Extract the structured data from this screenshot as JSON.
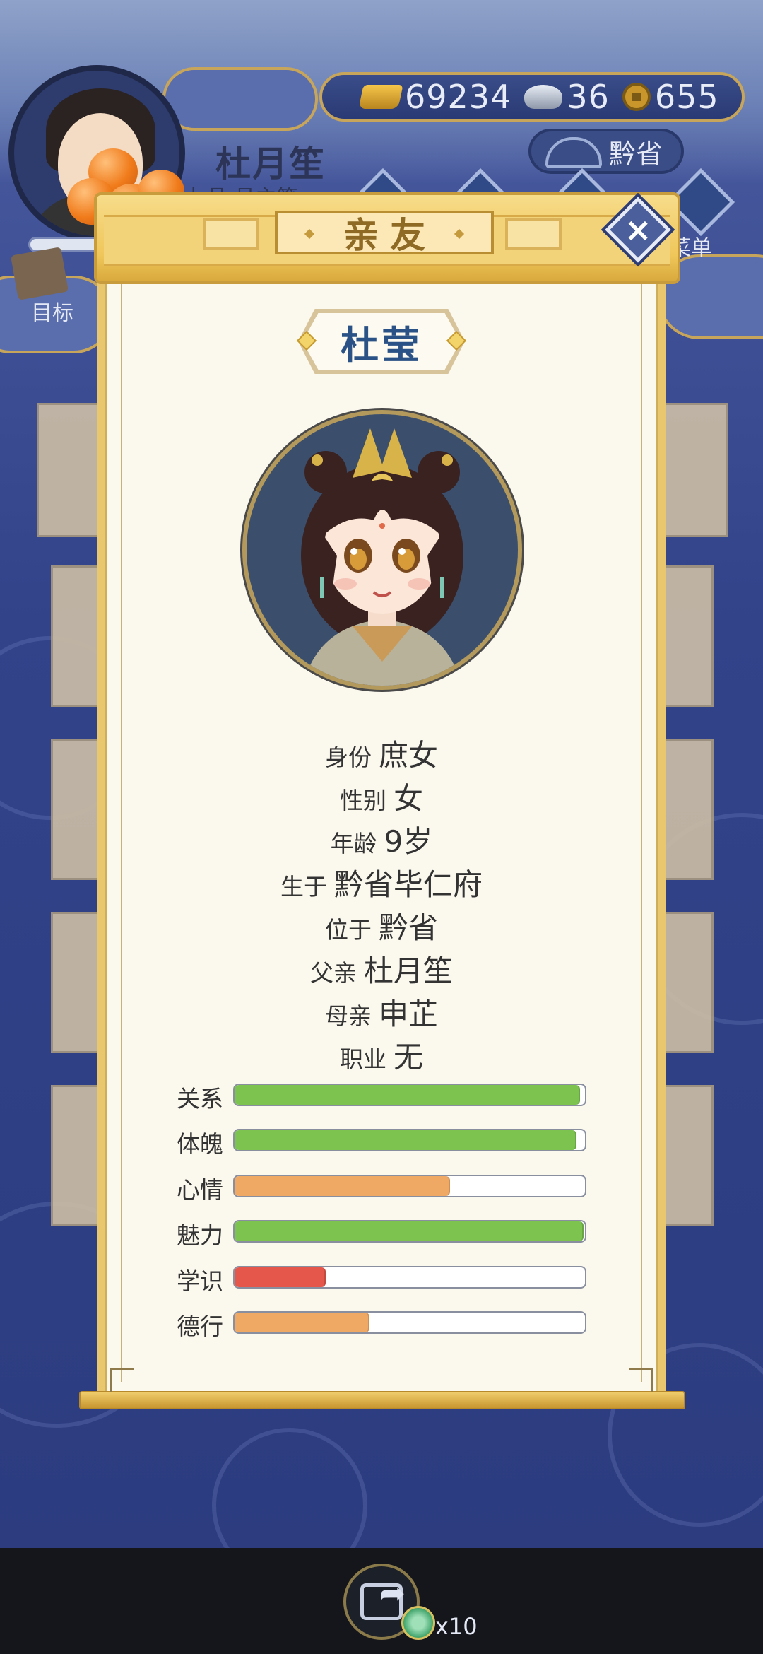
{
  "player": {
    "name": "杜月笙",
    "rank": "九品·县主簿"
  },
  "currency": {
    "gold": "69234",
    "silver": "36",
    "coins": "655"
  },
  "top_nav": {
    "province": "黔省",
    "target_label": "目标",
    "menu_label": "菜单"
  },
  "dialog": {
    "title": "亲友",
    "close_icon": "close-icon"
  },
  "character": {
    "name": "杜莹",
    "info": [
      {
        "key": "身份",
        "value": "庶女"
      },
      {
        "key": "性别",
        "value": "女"
      },
      {
        "key": "年龄",
        "value": "9岁"
      },
      {
        "key": "生于",
        "value": "黔省毕仁府"
      },
      {
        "key": "位于",
        "value": "黔省"
      },
      {
        "key": "父亲",
        "value": "杜月笙"
      },
      {
        "key": "母亲",
        "value": "申芷"
      },
      {
        "key": "职业",
        "value": "无"
      }
    ],
    "stats": [
      {
        "label": "关系",
        "fraction": 0.985,
        "color": "#7cc34f"
      },
      {
        "label": "体魄",
        "fraction": 0.975,
        "color": "#7cc34f"
      },
      {
        "label": "心情",
        "fraction": 0.615,
        "color": "#f0a865"
      },
      {
        "label": "魅力",
        "fraction": 0.995,
        "color": "#7cc34f"
      },
      {
        "label": "学识",
        "fraction": 0.26,
        "color": "#e5574a"
      },
      {
        "label": "德行",
        "fraction": 0.385,
        "color": "#f0a865"
      }
    ]
  },
  "bottom": {
    "share_count": "x10"
  }
}
